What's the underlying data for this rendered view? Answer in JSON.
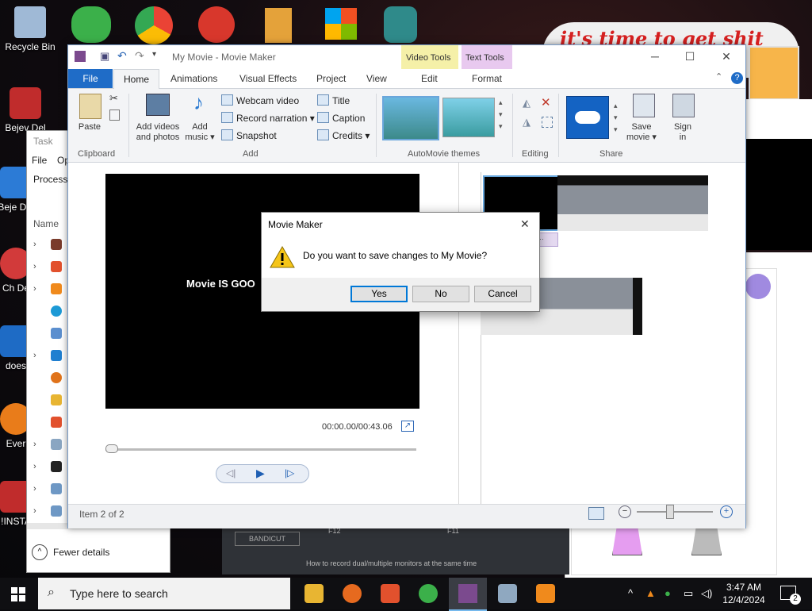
{
  "desktop": {
    "icons": [
      {
        "label": "Recycle Bin",
        "color": "#7fa4c8"
      },
      {
        "label": "Bejev Del",
        "color": "#d23a3a"
      },
      {
        "label": "Beje Del",
        "color": "#2c7bd6"
      },
      {
        "label": "Ch De",
        "color": "#d23a3a"
      },
      {
        "label": "does",
        "color": "#1e6bc5"
      },
      {
        "label": "Ever",
        "color": "#e97c1a"
      },
      {
        "label": "!INSTA",
        "color": "#d23a3a"
      }
    ],
    "banner_text": "it's time to get shit"
  },
  "task_manager": {
    "title": "Task",
    "menu_file": "File",
    "menu_options": "Op",
    "tab_processes": "Processe",
    "col_name": "Name",
    "fewer_details": "Fewer details"
  },
  "movie_maker": {
    "title": "My Movie - Movie Maker",
    "context_video_tools": "Video Tools",
    "context_text_tools": "Text Tools",
    "tabs": {
      "file": "File",
      "home": "Home",
      "animations": "Animations",
      "visual_effects": "Visual Effects",
      "project": "Project",
      "view": "View",
      "edit": "Edit",
      "format": "Format"
    },
    "ribbon": {
      "paste": "Paste",
      "clipboard": "Clipboard",
      "add_videos_l1": "Add videos",
      "add_videos_l2": "and photos",
      "add_music_l1": "Add",
      "add_music_l2": "music ▾",
      "webcam_video": "Webcam video",
      "record_narration": "Record narration ▾",
      "snapshot": "Snapshot",
      "title": "Title",
      "caption": "Caption",
      "credits": "Credits ▾",
      "add": "Add",
      "automovie_themes": "AutoMovie themes",
      "editing": "Editing",
      "save_movie_l1": "Save",
      "save_movie_l2": "movie ▾",
      "sign_in_l1": "Sign",
      "sign_in_l2": "in",
      "share": "Share"
    },
    "preview": {
      "overlay_text": "Movie IS GOO",
      "timecode": "00:00.00/00:43.06"
    },
    "status": "Item 2 of 2"
  },
  "bandicut": {
    "logo": "BANDICUT",
    "f12": "F12",
    "f11": "F11",
    "hint": "How to record dual/multiple monitors at the same time"
  },
  "dialog": {
    "title": "Movie Maker",
    "message": "Do you want to save changes to My Movie?",
    "yes": "Yes",
    "no": "No",
    "cancel": "Cancel"
  },
  "taskbar": {
    "search_placeholder": "Type here to search",
    "time": "3:47 AM",
    "date": "12/4/2024",
    "notification_count": "2"
  }
}
